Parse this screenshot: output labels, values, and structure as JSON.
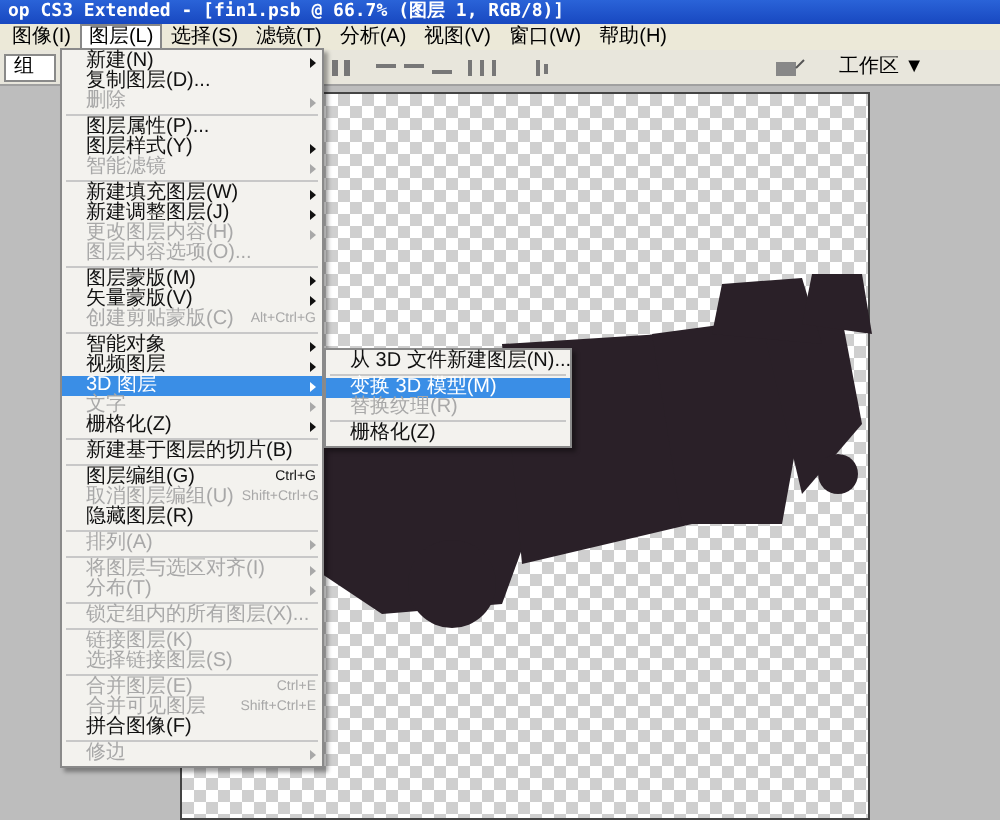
{
  "window": {
    "title": "op CS3 Extended - [fin1.psb @ 66.7% (图层 1, RGB/8)]"
  },
  "menubar": [
    {
      "label": "图像(I)",
      "selected": false
    },
    {
      "label": "图层(L)",
      "selected": true
    },
    {
      "label": "选择(S)",
      "selected": false
    },
    {
      "label": "滤镜(T)",
      "selected": false
    },
    {
      "label": "分析(A)",
      "selected": false
    },
    {
      "label": "视图(V)",
      "selected": false
    },
    {
      "label": "窗口(W)",
      "selected": false
    },
    {
      "label": "帮助(H)",
      "selected": false
    }
  ],
  "options_bar": {
    "field_value": "组",
    "workspace_button": "工作区 ▼"
  },
  "layer_menu": [
    {
      "kind": "item",
      "label": "新建(N)",
      "submenu": true,
      "disabled": false,
      "selected": false
    },
    {
      "kind": "item",
      "label": "复制图层(D)...",
      "submenu": false,
      "disabled": false,
      "selected": false
    },
    {
      "kind": "item",
      "label": "删除",
      "submenu": true,
      "disabled": true,
      "selected": false
    },
    {
      "kind": "separator"
    },
    {
      "kind": "item",
      "label": "图层属性(P)...",
      "submenu": false,
      "disabled": false,
      "selected": false
    },
    {
      "kind": "item",
      "label": "图层样式(Y)",
      "submenu": true,
      "disabled": false,
      "selected": false
    },
    {
      "kind": "item",
      "label": "智能滤镜",
      "submenu": true,
      "disabled": true,
      "selected": false
    },
    {
      "kind": "separator"
    },
    {
      "kind": "item",
      "label": "新建填充图层(W)",
      "submenu": true,
      "disabled": false,
      "selected": false
    },
    {
      "kind": "item",
      "label": "新建调整图层(J)",
      "submenu": true,
      "disabled": false,
      "selected": false
    },
    {
      "kind": "item",
      "label": "更改图层内容(H)",
      "submenu": true,
      "disabled": true,
      "selected": false
    },
    {
      "kind": "item",
      "label": "图层内容选项(O)...",
      "submenu": false,
      "disabled": true,
      "selected": false
    },
    {
      "kind": "separator"
    },
    {
      "kind": "item",
      "label": "图层蒙版(M)",
      "submenu": true,
      "disabled": false,
      "selected": false
    },
    {
      "kind": "item",
      "label": "矢量蒙版(V)",
      "submenu": true,
      "disabled": false,
      "selected": false
    },
    {
      "kind": "item",
      "label": "创建剪贴蒙版(C)",
      "shortcut": "Alt+Ctrl+G",
      "submenu": false,
      "disabled": true,
      "selected": false
    },
    {
      "kind": "separator"
    },
    {
      "kind": "item",
      "label": "智能对象",
      "submenu": true,
      "disabled": false,
      "selected": false
    },
    {
      "kind": "item",
      "label": "视频图层",
      "submenu": true,
      "disabled": false,
      "selected": false
    },
    {
      "kind": "item",
      "label": "3D 图层",
      "submenu": true,
      "disabled": false,
      "selected": true
    },
    {
      "kind": "item",
      "label": "文字",
      "submenu": true,
      "disabled": true,
      "selected": false
    },
    {
      "kind": "item",
      "label": "栅格化(Z)",
      "submenu": true,
      "disabled": false,
      "selected": false
    },
    {
      "kind": "separator"
    },
    {
      "kind": "item",
      "label": "新建基于图层的切片(B)",
      "submenu": false,
      "disabled": false,
      "selected": false
    },
    {
      "kind": "separator"
    },
    {
      "kind": "item",
      "label": "图层编组(G)",
      "shortcut": "Ctrl+G",
      "submenu": false,
      "disabled": false,
      "selected": false
    },
    {
      "kind": "item",
      "label": "取消图层编组(U)",
      "shortcut": "Shift+Ctrl+G",
      "submenu": false,
      "disabled": true,
      "selected": false
    },
    {
      "kind": "item",
      "label": "隐藏图层(R)",
      "submenu": false,
      "disabled": false,
      "selected": false
    },
    {
      "kind": "separator"
    },
    {
      "kind": "item",
      "label": "排列(A)",
      "submenu": true,
      "disabled": true,
      "selected": false
    },
    {
      "kind": "separator"
    },
    {
      "kind": "item",
      "label": "将图层与选区对齐(I)",
      "submenu": true,
      "disabled": true,
      "selected": false
    },
    {
      "kind": "item",
      "label": "分布(T)",
      "submenu": true,
      "disabled": true,
      "selected": false
    },
    {
      "kind": "separator"
    },
    {
      "kind": "item",
      "label": "锁定组内的所有图层(X)...",
      "submenu": false,
      "disabled": true,
      "selected": false
    },
    {
      "kind": "separator"
    },
    {
      "kind": "item",
      "label": "链接图层(K)",
      "submenu": false,
      "disabled": true,
      "selected": false
    },
    {
      "kind": "item",
      "label": "选择链接图层(S)",
      "submenu": false,
      "disabled": true,
      "selected": false
    },
    {
      "kind": "separator"
    },
    {
      "kind": "item",
      "label": "合并图层(E)",
      "shortcut": "Ctrl+E",
      "submenu": false,
      "disabled": true,
      "selected": false
    },
    {
      "kind": "item",
      "label": "合并可见图层",
      "shortcut": "Shift+Ctrl+E",
      "submenu": false,
      "disabled": true,
      "selected": false
    },
    {
      "kind": "item",
      "label": "拼合图像(F)",
      "submenu": false,
      "disabled": false,
      "selected": false
    },
    {
      "kind": "separator"
    },
    {
      "kind": "item",
      "label": "修边",
      "submenu": true,
      "disabled": true,
      "selected": false
    }
  ],
  "submenu_3d": [
    {
      "kind": "item",
      "label": "从 3D 文件新建图层(N)...",
      "disabled": false,
      "selected": false
    },
    {
      "kind": "separator"
    },
    {
      "kind": "item",
      "label": "变换 3D 模型(M)",
      "disabled": false,
      "selected": true
    },
    {
      "kind": "item",
      "label": "替换纹理(R)",
      "disabled": true,
      "selected": false
    },
    {
      "kind": "separator"
    },
    {
      "kind": "item",
      "label": "栅格化(Z)",
      "disabled": false,
      "selected": false
    }
  ]
}
